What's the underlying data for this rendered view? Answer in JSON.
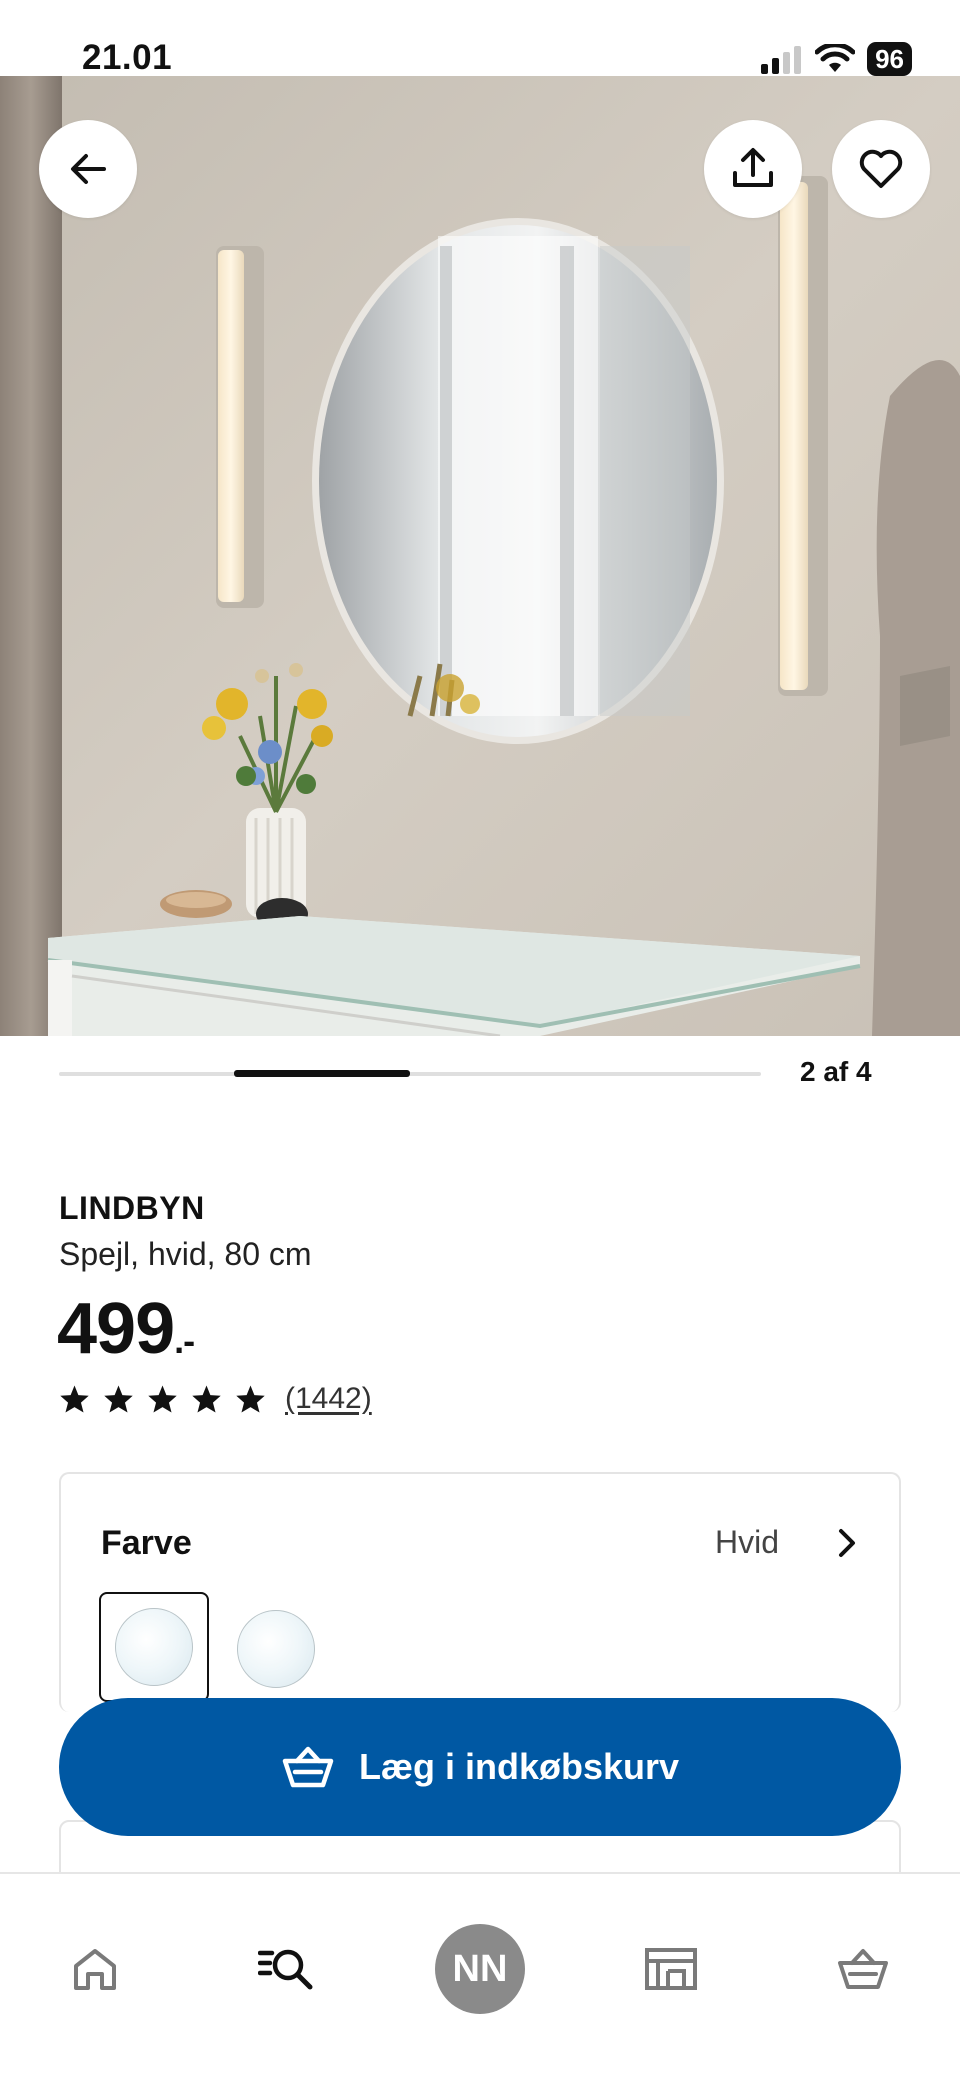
{
  "status_bar": {
    "time": "21.01",
    "battery": "96"
  },
  "hero": {
    "back_icon": "arrow-left-icon",
    "share_icon": "share-icon",
    "favorite_icon": "heart-icon"
  },
  "carousel": {
    "counter": "2 af 4",
    "current": 2,
    "total": 4
  },
  "product": {
    "name": "LINDBYN",
    "description": "Spejl, hvid, 80 cm",
    "price": "499",
    "price_suffix": ".-",
    "rating": 5,
    "rating_count": "(1442)"
  },
  "color_option": {
    "label": "Farve",
    "value": "Hvid",
    "swatch_count": 2,
    "selected_index": 0
  },
  "cart": {
    "label": "Læg i indkøbskurv",
    "icon": "basket-icon"
  },
  "bottom_nav": {
    "items": [
      "home-icon",
      "search-icon",
      "profile-avatar",
      "stores-icon",
      "cart-icon"
    ],
    "avatar_initials": "NN"
  },
  "colors": {
    "primary_blue": "#0058a3",
    "avatar_grey": "#8a8a8a"
  }
}
